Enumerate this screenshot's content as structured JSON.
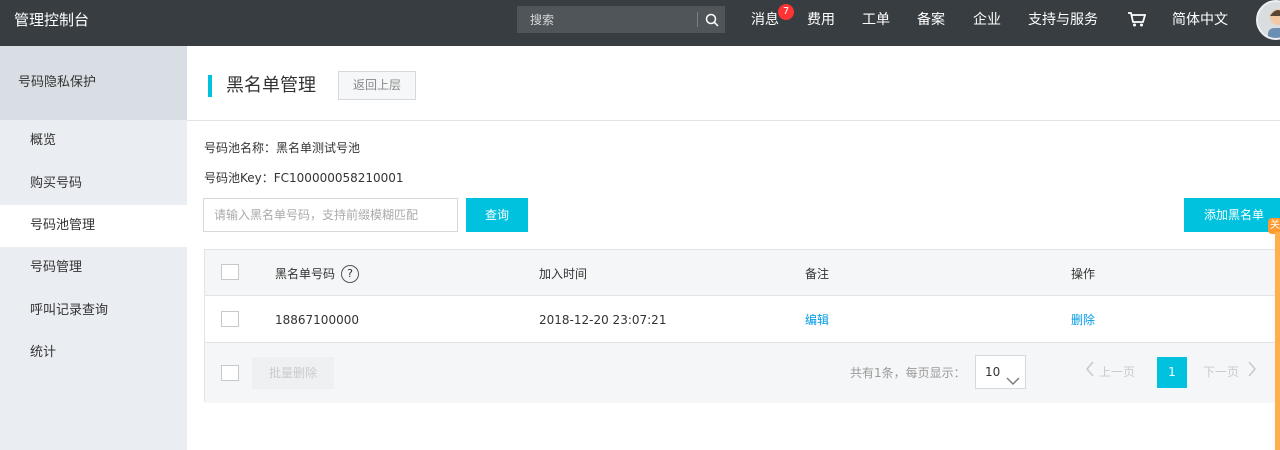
{
  "topbar": {
    "brand": "管理控制台",
    "search_placeholder": "搜索",
    "nav": [
      {
        "label": "消息",
        "badge": "7"
      },
      {
        "label": "费用"
      },
      {
        "label": "工单"
      },
      {
        "label": "备案"
      },
      {
        "label": "企业"
      },
      {
        "label": "支持与服务"
      },
      {
        "label": "简体中文"
      }
    ]
  },
  "sidebar": {
    "header": "号码隐私保护",
    "items": [
      {
        "label": "概览"
      },
      {
        "label": "购买号码"
      },
      {
        "label": "号码池管理",
        "active": true
      },
      {
        "label": "号码管理"
      },
      {
        "label": "呼叫记录查询"
      },
      {
        "label": "统计"
      }
    ]
  },
  "page": {
    "title": "黑名单管理",
    "back_label": "返回上层",
    "pool_name": "号码池名称：黑名单测试号池",
    "pool_key": "号码池Key：FC100000058210001",
    "filter_placeholder": "请输入黑名单号码，支持前缀模糊匹配",
    "query_label": "查询",
    "add_label": "添加黑名单"
  },
  "table": {
    "columns": [
      "黑名单号码",
      "加入时间",
      "备注",
      "操作"
    ],
    "help_glyph": "?",
    "rows": [
      {
        "number": "18867100000",
        "time": "2018-12-20 23:07:21",
        "remark_action": "编辑",
        "op_action": "删除"
      }
    ],
    "footer": {
      "batch_delete": "批量删除",
      "total": "共有1条，每页显示：",
      "page_size": "10",
      "prev": "上一页",
      "current_page": "1",
      "next": "下一页"
    }
  },
  "side_tag": "关",
  "colors": {
    "topbar_bg": "#373d41",
    "accent": "#00c1de",
    "link": "#0099e5",
    "badge": "#ff3333"
  }
}
